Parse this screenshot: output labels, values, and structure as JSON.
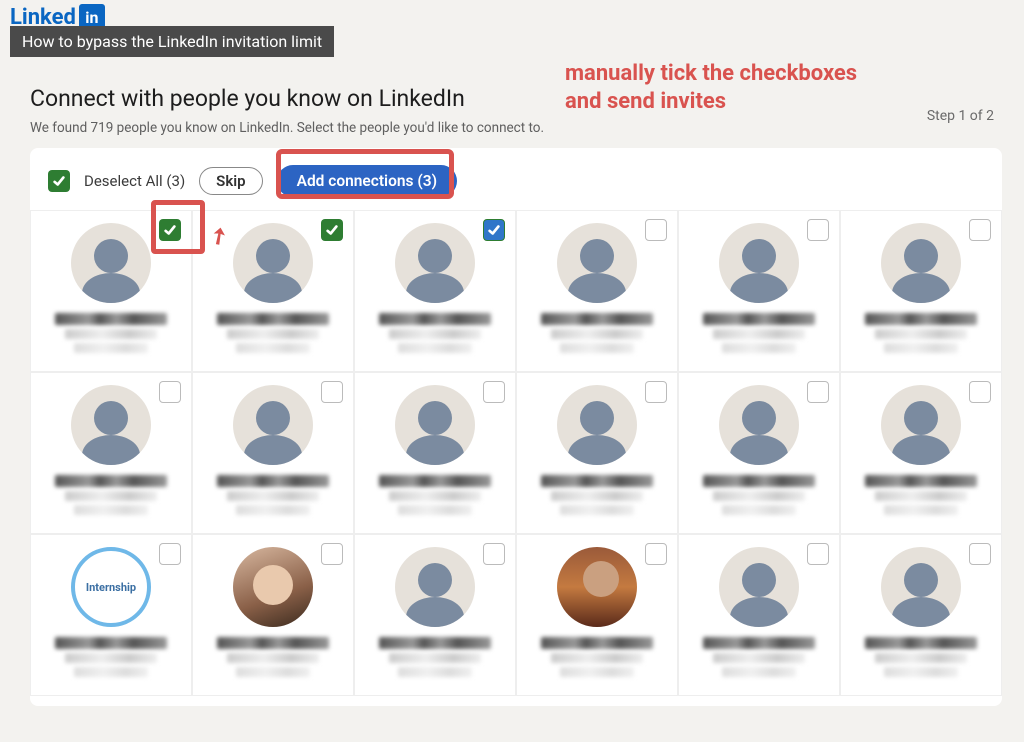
{
  "brand": {
    "name": "Linked",
    "suffix": "in"
  },
  "caption": "How to bypass the LinkedIn invitation limit",
  "annotation": {
    "line1": "manually tick the checkboxes",
    "line2": "and send invites"
  },
  "header": {
    "title": "Connect with people you know on LinkedIn",
    "subtitle": "We found 719 people you know on LinkedIn. Select the people you'd like to connect to.",
    "step_label": "Step 1 of 2"
  },
  "toolbar": {
    "deselect_label": "Deselect All (3)",
    "skip_label": "Skip",
    "add_label": "Add connections (3)",
    "selected_count": 3
  },
  "grid": {
    "rows": 3,
    "cols": 6,
    "cells": [
      {
        "checked": true,
        "variant": "green",
        "avatar": "default",
        "row": 0,
        "col": 0
      },
      {
        "checked": true,
        "variant": "green",
        "avatar": "default",
        "row": 0,
        "col": 1
      },
      {
        "checked": true,
        "variant": "blue",
        "avatar": "default",
        "row": 0,
        "col": 2
      },
      {
        "checked": false,
        "variant": "",
        "avatar": "default",
        "row": 0,
        "col": 3
      },
      {
        "checked": false,
        "variant": "",
        "avatar": "default",
        "row": 0,
        "col": 4
      },
      {
        "checked": false,
        "variant": "",
        "avatar": "default",
        "row": 0,
        "col": 5
      },
      {
        "checked": false,
        "variant": "",
        "avatar": "default",
        "row": 1,
        "col": 0
      },
      {
        "checked": false,
        "variant": "",
        "avatar": "default",
        "row": 1,
        "col": 1
      },
      {
        "checked": false,
        "variant": "",
        "avatar": "default",
        "row": 1,
        "col": 2
      },
      {
        "checked": false,
        "variant": "",
        "avatar": "default",
        "row": 1,
        "col": 3
      },
      {
        "checked": false,
        "variant": "",
        "avatar": "default",
        "row": 1,
        "col": 4
      },
      {
        "checked": false,
        "variant": "",
        "avatar": "default",
        "row": 1,
        "col": 5
      },
      {
        "checked": false,
        "variant": "",
        "avatar": "internship",
        "avatar_label": "Internship",
        "row": 2,
        "col": 0
      },
      {
        "checked": false,
        "variant": "",
        "avatar": "face1",
        "row": 2,
        "col": 1
      },
      {
        "checked": false,
        "variant": "",
        "avatar": "default",
        "row": 2,
        "col": 2
      },
      {
        "checked": false,
        "variant": "",
        "avatar": "face2",
        "row": 2,
        "col": 3
      },
      {
        "checked": false,
        "variant": "",
        "avatar": "default",
        "row": 2,
        "col": 4
      },
      {
        "checked": false,
        "variant": "",
        "avatar": "default",
        "row": 2,
        "col": 5
      }
    ]
  }
}
